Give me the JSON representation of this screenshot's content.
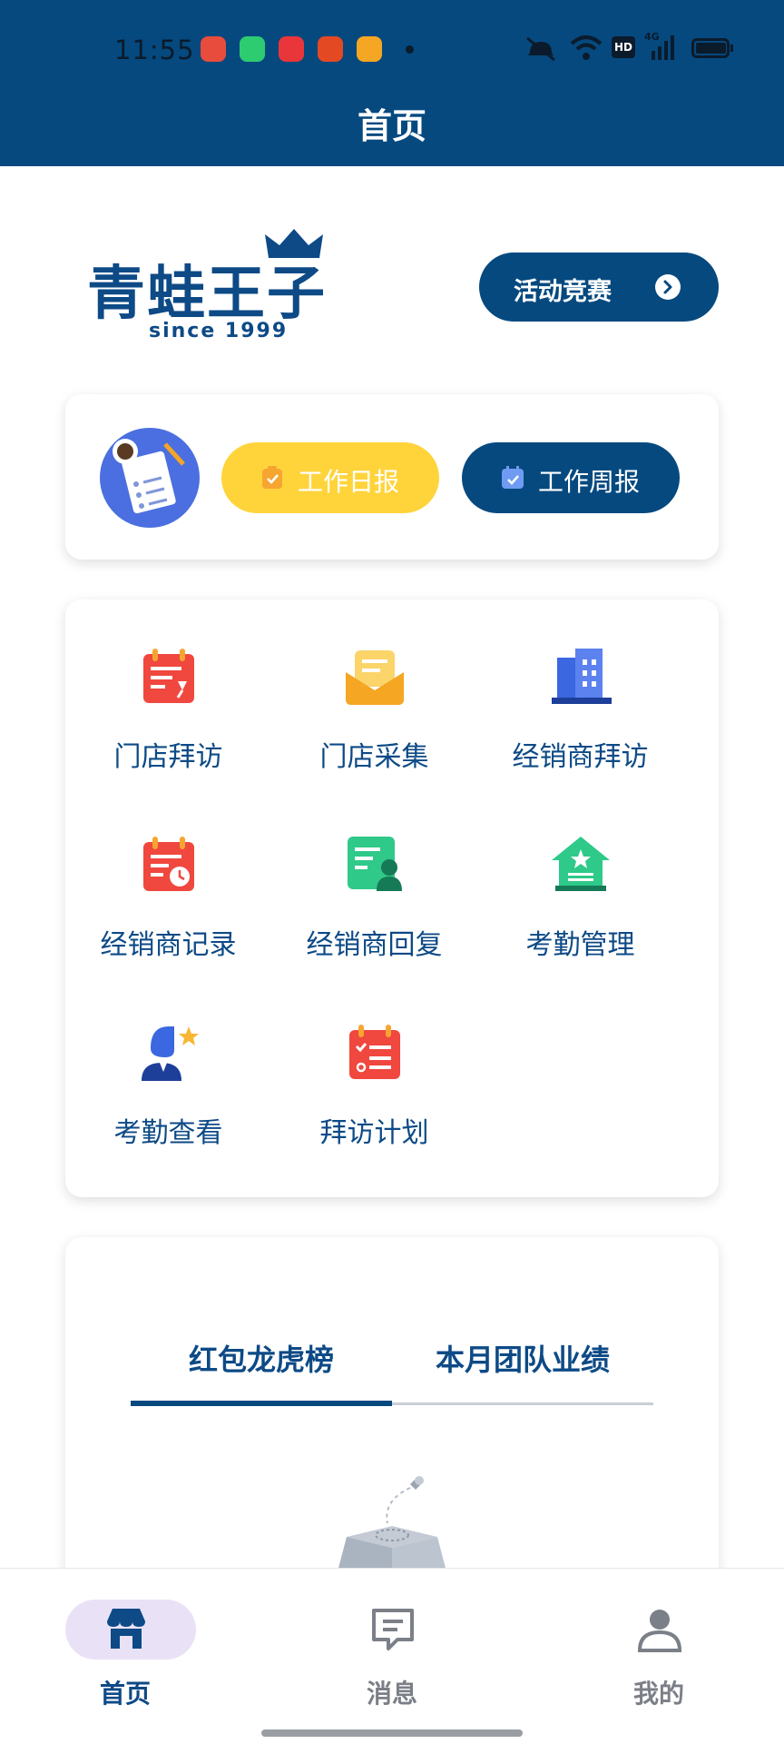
{
  "status_bar": {
    "time": "11:55",
    "notification_icons": [
      "gift-app-icon",
      "message-app-icon",
      "toutiao-app-icon",
      "taobao-app-icon",
      "video-app-icon"
    ],
    "right_icons": [
      "mute-icon",
      "wifi-icon",
      "hd-icon",
      "signal-4g-icon",
      "battery-icon"
    ],
    "signal_label": "4G",
    "hd_label": "HD"
  },
  "header": {
    "title": "首页"
  },
  "brand": {
    "logo_text": "青蛙王子",
    "logo_sub": "since 1999",
    "event_button": "活动竞赛"
  },
  "reports": {
    "daily": "工作日报",
    "weekly": "工作周报"
  },
  "grid": {
    "items": [
      {
        "label": "门店拜访",
        "icon": "calendar-pin-icon"
      },
      {
        "label": "门店采集",
        "icon": "envelope-icon"
      },
      {
        "label": "经销商拜访",
        "icon": "building-icon"
      },
      {
        "label": "经销商记录",
        "icon": "calendar-clock-icon"
      },
      {
        "label": "经销商回复",
        "icon": "document-person-icon"
      },
      {
        "label": "考勤管理",
        "icon": "house-star-icon"
      },
      {
        "label": "考勤查看",
        "icon": "person-star-icon"
      },
      {
        "label": "拜访计划",
        "icon": "calendar-checklist-icon"
      }
    ]
  },
  "ranking": {
    "tabs": [
      "红包龙虎榜",
      "本月团队业绩"
    ],
    "active_tab": 0
  },
  "nav": {
    "items": [
      {
        "label": "首页",
        "icon": "store-icon"
      },
      {
        "label": "消息",
        "icon": "chat-icon"
      },
      {
        "label": "我的",
        "icon": "user-icon"
      }
    ],
    "active": 0
  },
  "colors": {
    "primary": "#05497f",
    "accent_yellow": "#ffd43b",
    "red": "#f0473e",
    "green": "#2fc98a",
    "blue": "#3b67e0"
  }
}
